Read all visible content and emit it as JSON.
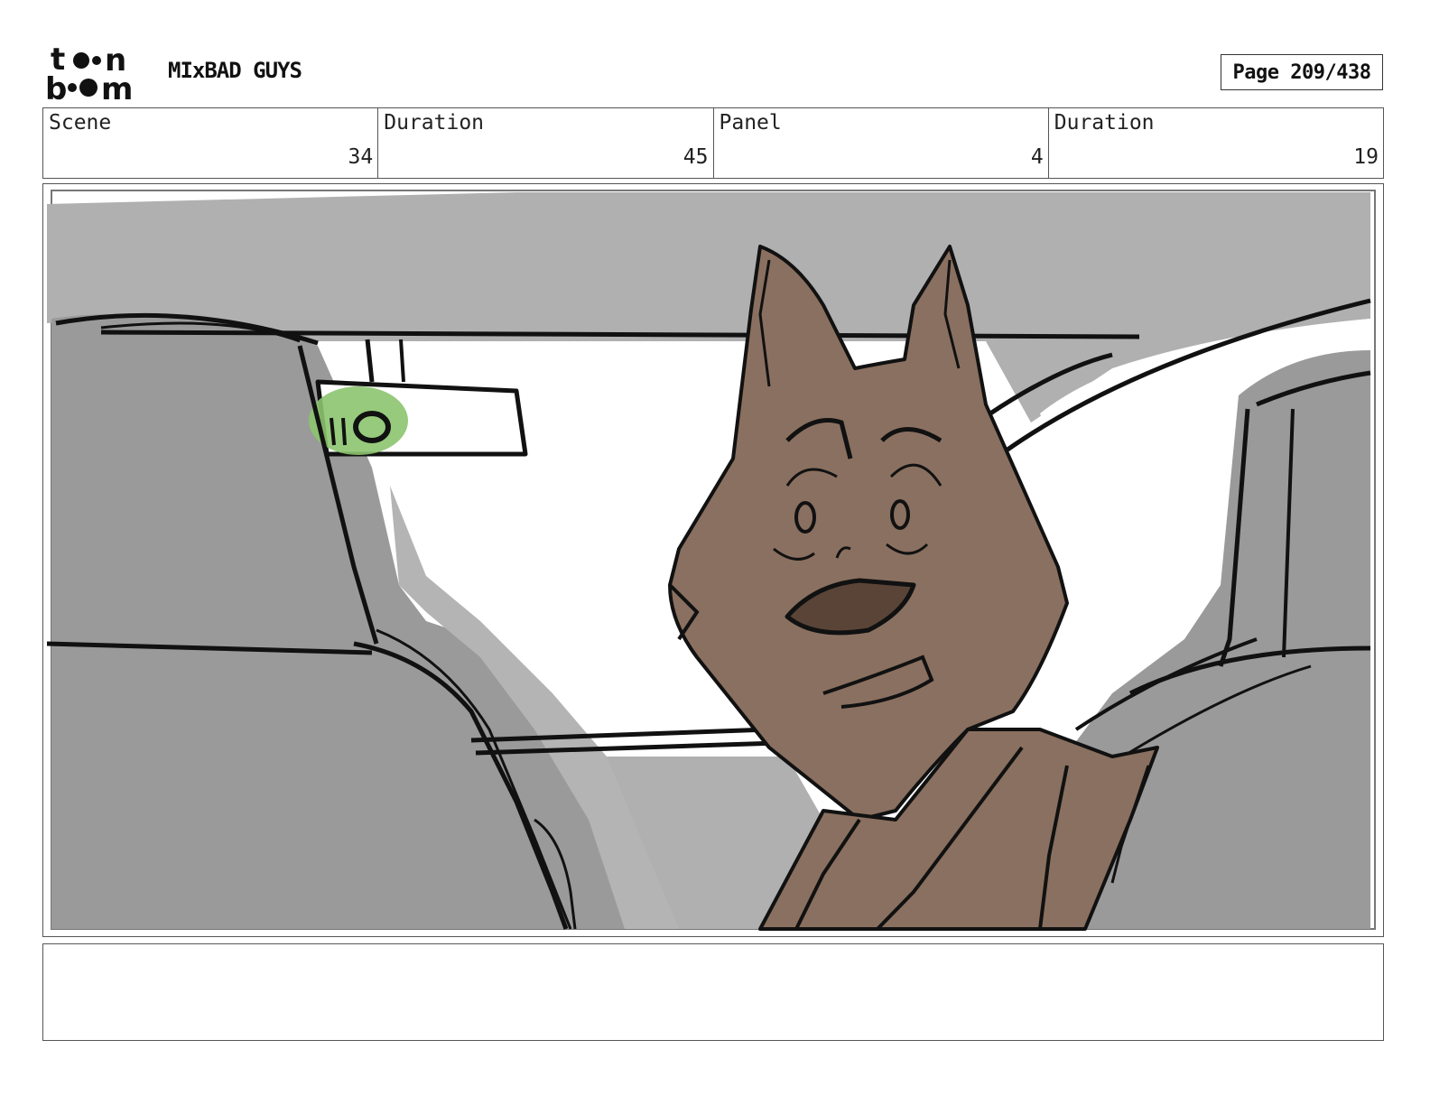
{
  "header": {
    "logo_text_top": "toon",
    "logo_text_bottom": "boom",
    "project_title": "MIxBAD GUYS",
    "page_label": "Page 209/438"
  },
  "info": {
    "scene_label": "Scene",
    "scene_value": "34",
    "duration1_label": "Duration",
    "duration1_value": "45",
    "panel_label": "Panel",
    "panel_value": "4",
    "duration2_label": "Duration",
    "duration2_value": "19"
  },
  "colors": {
    "sky_gray": "#b0b0b0",
    "seat_gray": "#9a9a9a",
    "window_white": "#ffffff",
    "fur_brown": "#8a7060",
    "mirror_green": "#8cc46e",
    "ink": "#111111"
  },
  "notes": {
    "text": ""
  }
}
